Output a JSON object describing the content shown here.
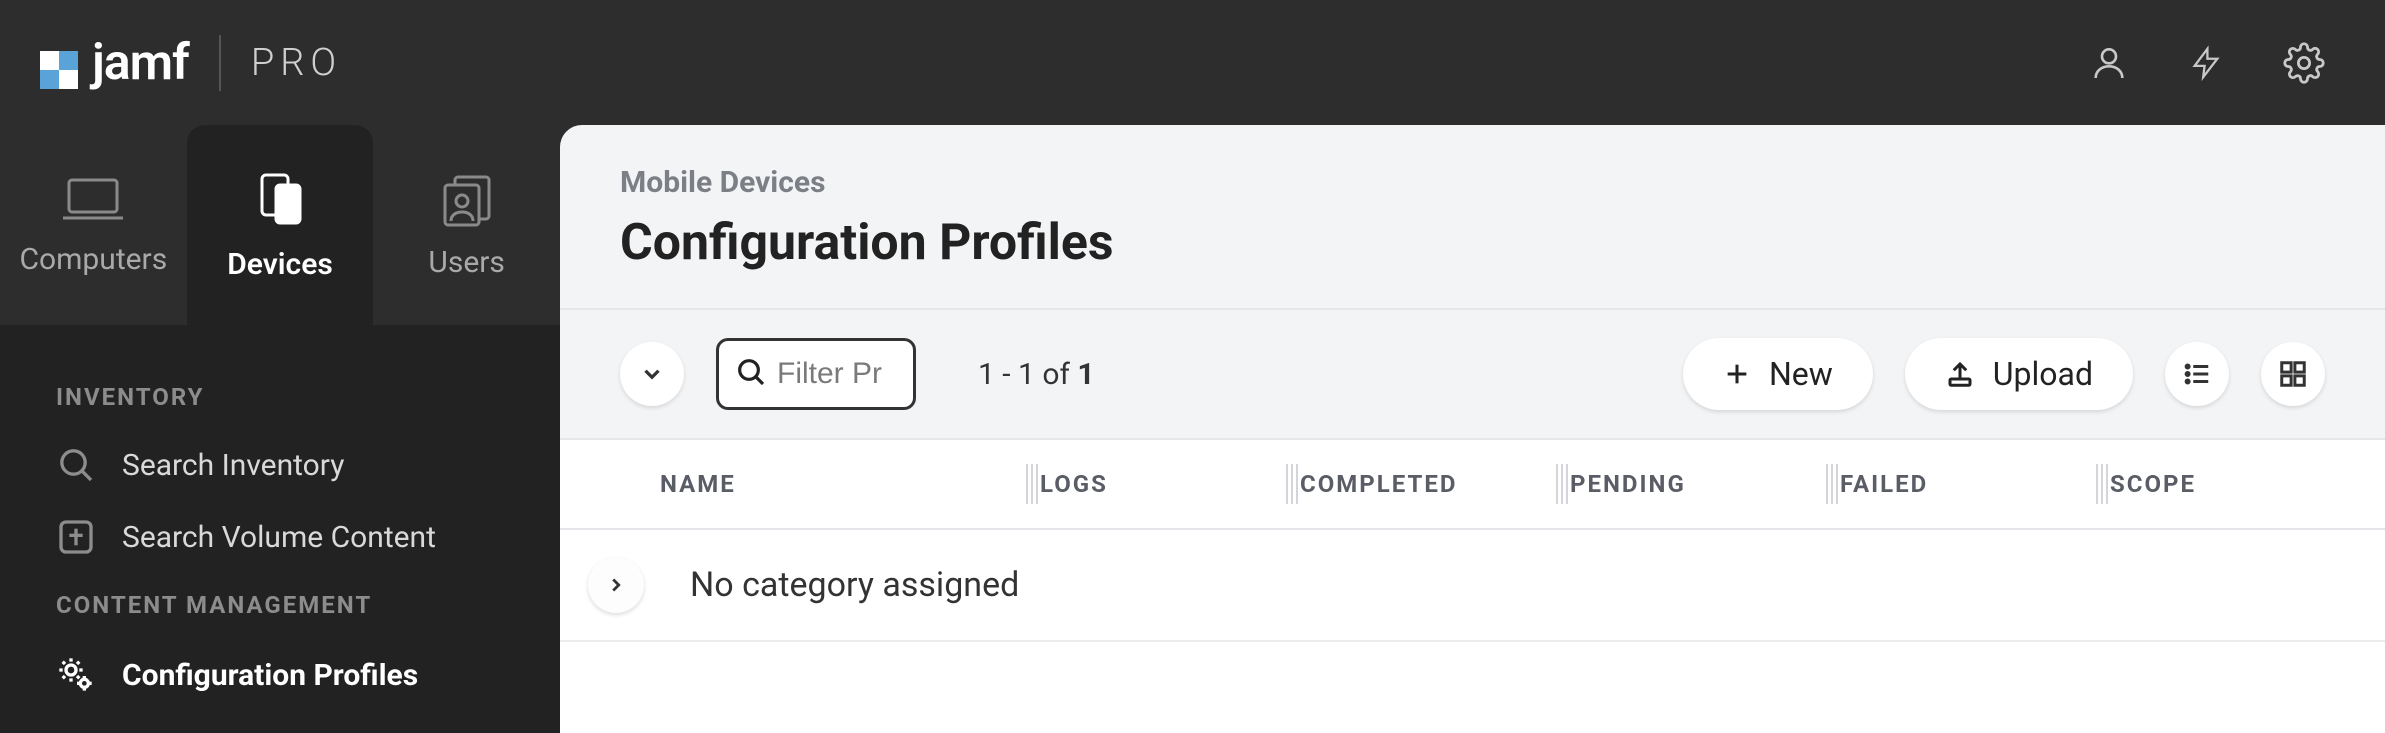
{
  "brand": {
    "name": "jamf",
    "suffix": "PRO"
  },
  "top_nav": {
    "tabs": [
      {
        "id": "computers",
        "label": "Computers",
        "active": false
      },
      {
        "id": "devices",
        "label": "Devices",
        "active": true
      },
      {
        "id": "users",
        "label": "Users",
        "active": false
      }
    ]
  },
  "sidebar": {
    "sections": [
      {
        "heading": "INVENTORY",
        "items": [
          {
            "id": "search-inventory",
            "label": "Search Inventory",
            "icon": "search-icon",
            "active": false
          },
          {
            "id": "search-volume-content",
            "label": "Search Volume Content",
            "icon": "app-icon",
            "active": false
          }
        ]
      },
      {
        "heading": "CONTENT MANAGEMENT",
        "items": [
          {
            "id": "configuration-profiles",
            "label": "Configuration Profiles",
            "icon": "gear-pair-icon",
            "active": true
          }
        ]
      }
    ]
  },
  "header": {
    "breadcrumb": "Mobile Devices",
    "title": "Configuration Profiles"
  },
  "toolbar": {
    "filter_placeholder": "Filter Pr",
    "range_prefix": "1 - 1 of ",
    "range_total": "1",
    "new_label": "New",
    "upload_label": "Upload"
  },
  "table": {
    "columns": [
      {
        "key": "name",
        "label": "NAME"
      },
      {
        "key": "logs",
        "label": "LOGS"
      },
      {
        "key": "completed",
        "label": "COMPLETED"
      },
      {
        "key": "pending",
        "label": "PENDING"
      },
      {
        "key": "failed",
        "label": "FAILED"
      },
      {
        "key": "scope",
        "label": "SCOPE"
      }
    ],
    "groups": [
      {
        "label": "No category assigned"
      }
    ]
  }
}
